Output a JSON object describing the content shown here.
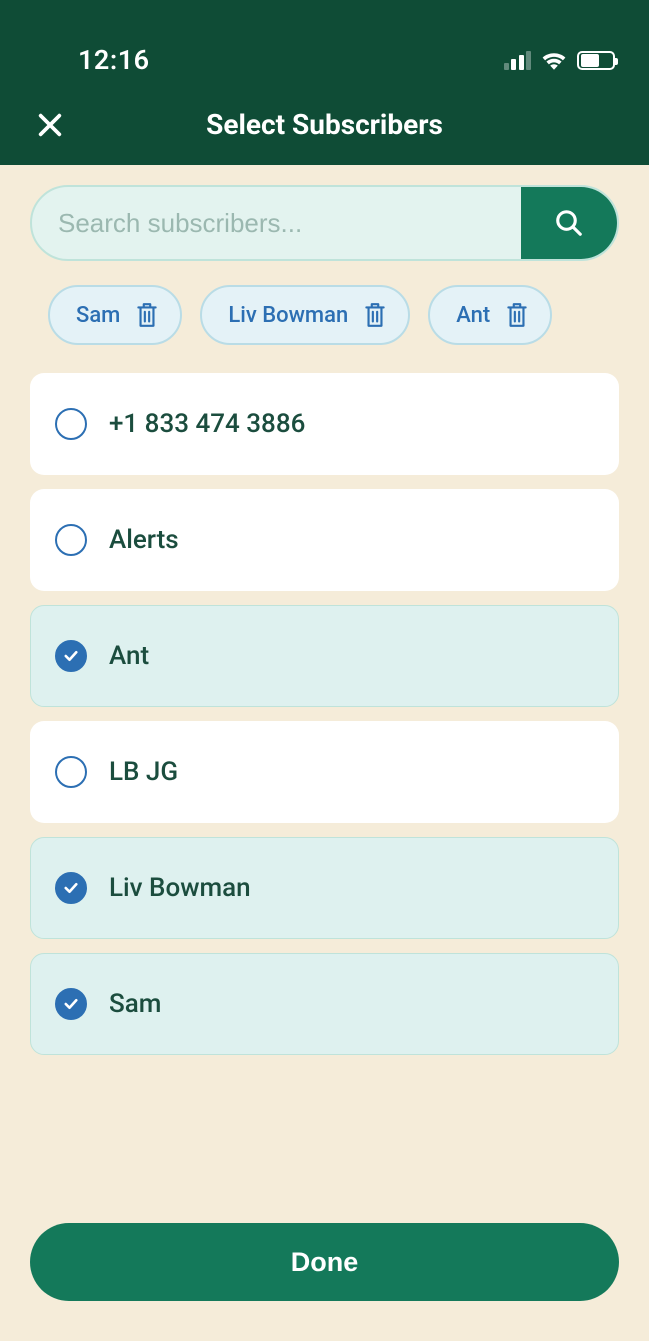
{
  "status": {
    "time": "12:16"
  },
  "nav": {
    "title": "Select Subscribers"
  },
  "search": {
    "placeholder": "Search subscribers..."
  },
  "chips": [
    {
      "label": "Sam"
    },
    {
      "label": "Liv Bowman"
    },
    {
      "label": "Ant"
    }
  ],
  "rows": [
    {
      "label": "+1 833 474 3886",
      "selected": false
    },
    {
      "label": "Alerts",
      "selected": false
    },
    {
      "label": "Ant",
      "selected": true
    },
    {
      "label": "LB JG",
      "selected": false
    },
    {
      "label": "Liv Bowman",
      "selected": true
    },
    {
      "label": "Sam",
      "selected": true
    }
  ],
  "done": {
    "label": "Done"
  }
}
